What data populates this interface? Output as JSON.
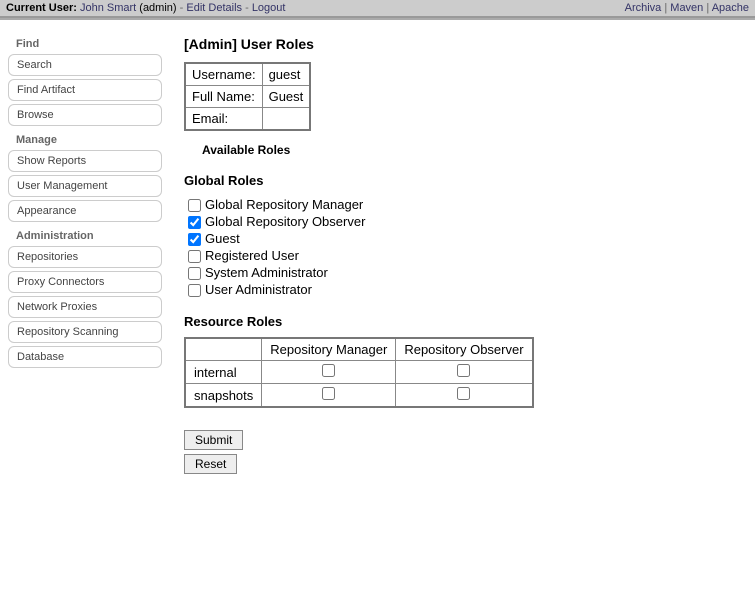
{
  "topbar": {
    "current_user_label": "Current User:",
    "username": "John Smart",
    "role_paren": "(admin)",
    "edit_details": "Edit Details",
    "logout": "Logout",
    "right_links": [
      "Archiva",
      "Maven",
      "Apache"
    ]
  },
  "sidebar": {
    "find": {
      "heading": "Find",
      "items": [
        "Search",
        "Find Artifact",
        "Browse"
      ]
    },
    "manage": {
      "heading": "Manage",
      "items": [
        "Show Reports",
        "User Management",
        "Appearance"
      ]
    },
    "administration": {
      "heading": "Administration",
      "items": [
        "Repositories",
        "Proxy Connectors",
        "Network Proxies",
        "Repository Scanning",
        "Database"
      ]
    }
  },
  "page": {
    "title": "[Admin] User Roles",
    "userinfo": {
      "username_label": "Username:",
      "username_value": "guest",
      "fullname_label": "Full Name:",
      "fullname_value": "Guest",
      "email_label": "Email:",
      "email_value": ""
    },
    "available_roles_heading": "Available Roles",
    "global_roles_heading": "Global Roles",
    "global_roles": [
      {
        "label": "Global Repository Manager",
        "checked": false
      },
      {
        "label": "Global Repository Observer",
        "checked": true
      },
      {
        "label": "Guest",
        "checked": true
      },
      {
        "label": "Registered User",
        "checked": false
      },
      {
        "label": "System Administrator",
        "checked": false
      },
      {
        "label": "User Administrator",
        "checked": false
      }
    ],
    "resource_roles_heading": "Resource Roles",
    "resource_cols": [
      "Repository Manager",
      "Repository Observer"
    ],
    "resource_rows": [
      {
        "name": "internal",
        "checks": [
          false,
          false
        ]
      },
      {
        "name": "snapshots",
        "checks": [
          false,
          false
        ]
      }
    ],
    "submit": "Submit",
    "reset": "Reset"
  }
}
